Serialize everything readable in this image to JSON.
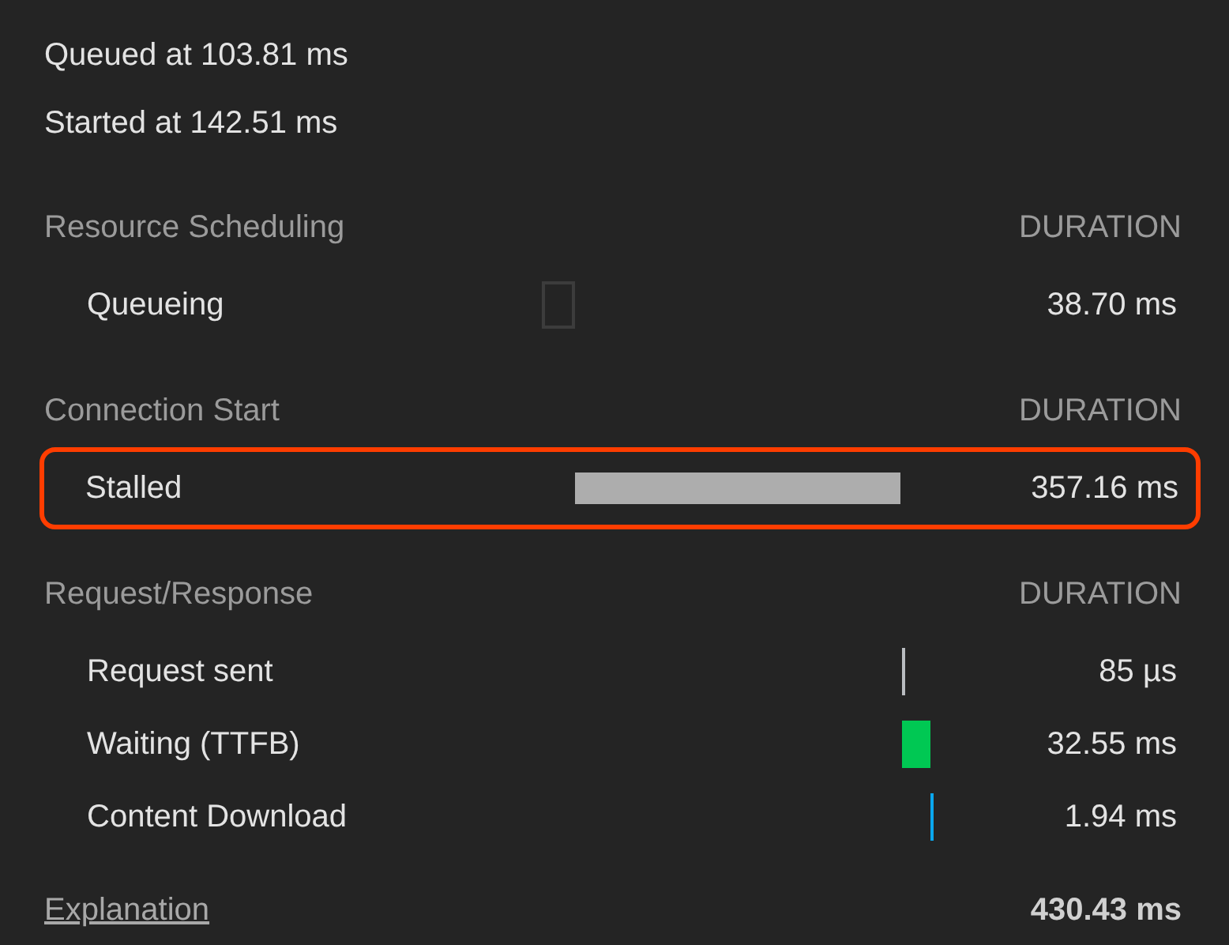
{
  "timestamps": [
    "Queued at 103.81 ms",
    "Started at 142.51 ms"
  ],
  "sections": [
    {
      "title": "Resource Scheduling",
      "column_heading": "DURATION",
      "highlighted": false,
      "rows": [
        {
          "label": "Queueing",
          "kind": "queueing",
          "duration": "38.70 ms"
        }
      ]
    },
    {
      "title": "Connection Start",
      "column_heading": "DURATION",
      "highlighted": true,
      "rows": [
        {
          "label": "Stalled",
          "kind": "stalled",
          "duration": "357.16 ms"
        }
      ]
    },
    {
      "title": "Request/Response",
      "column_heading": "DURATION",
      "highlighted": false,
      "rows": [
        {
          "label": "Request sent",
          "kind": "sending",
          "duration": "85 µs"
        },
        {
          "label": "Waiting (TTFB)",
          "kind": "waiting",
          "duration": "32.55 ms"
        },
        {
          "label": "Content Download",
          "kind": "download",
          "duration": "1.94 ms"
        }
      ]
    }
  ],
  "footer": {
    "link": "Explanation",
    "total": "430.43 ms"
  }
}
